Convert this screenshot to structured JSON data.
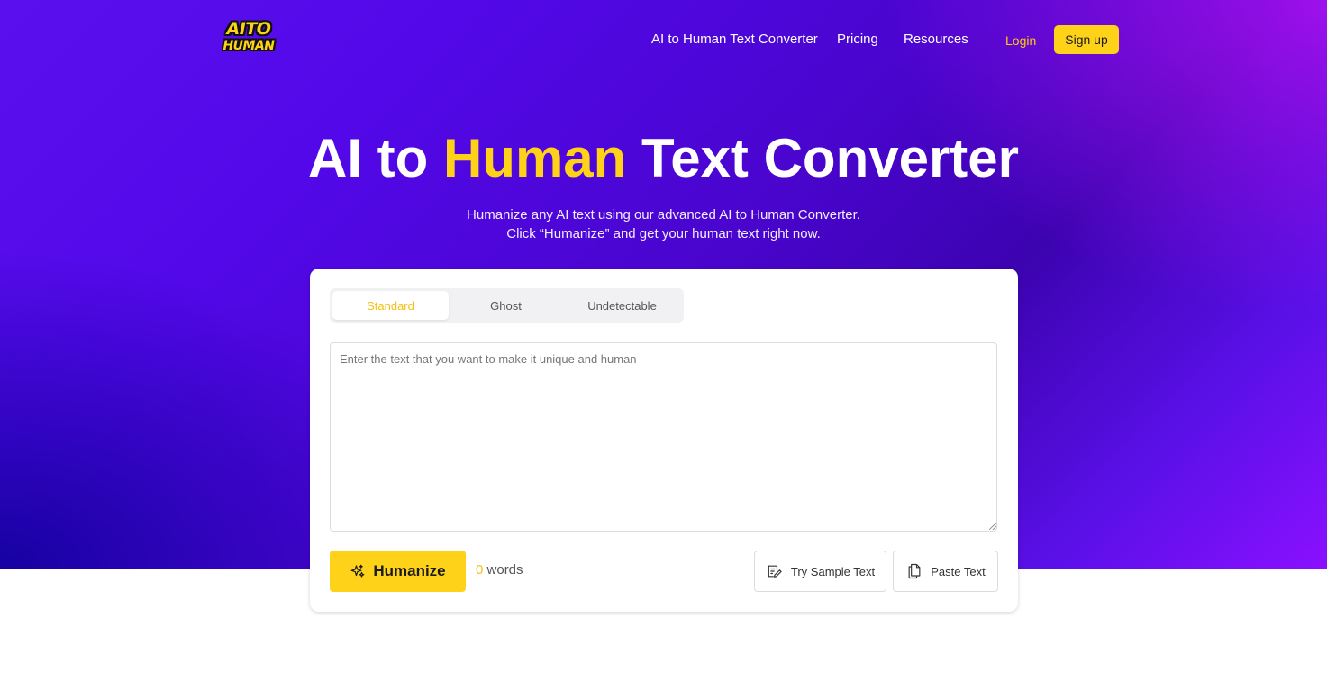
{
  "brand": {
    "logo_line1": "AITO",
    "logo_line2": "HUMAN"
  },
  "nav": {
    "links": [
      "AI to Human Text Converter",
      "Pricing",
      "Resources"
    ],
    "login": "Login",
    "signup": "Sign up"
  },
  "hero": {
    "title_part1": "AI to ",
    "title_accent": "Human",
    "title_part2": " Text Converter",
    "subtitle_line1": "Humanize any AI text using our advanced AI to Human Converter.",
    "subtitle_line2": "Click “Humanize” and get your human text right now."
  },
  "tool": {
    "modes": [
      "Standard",
      "Ghost",
      "Undetectable"
    ],
    "active_mode": "Standard",
    "input_placeholder": "Enter the text that you want to make it unique and human",
    "input_value": "",
    "humanize_label": "Humanize",
    "word_count": "0",
    "word_label": "words",
    "sample_label": "Try Sample Text",
    "paste_label": "Paste Text"
  },
  "colors": {
    "accent": "#ffd21a",
    "hero_gradient_start": "#1a00a8",
    "hero_gradient_end": "#a412ff"
  },
  "icons": {
    "humanize": "sparkles-icon",
    "sample": "edit-note-icon",
    "paste": "copy-icon"
  }
}
